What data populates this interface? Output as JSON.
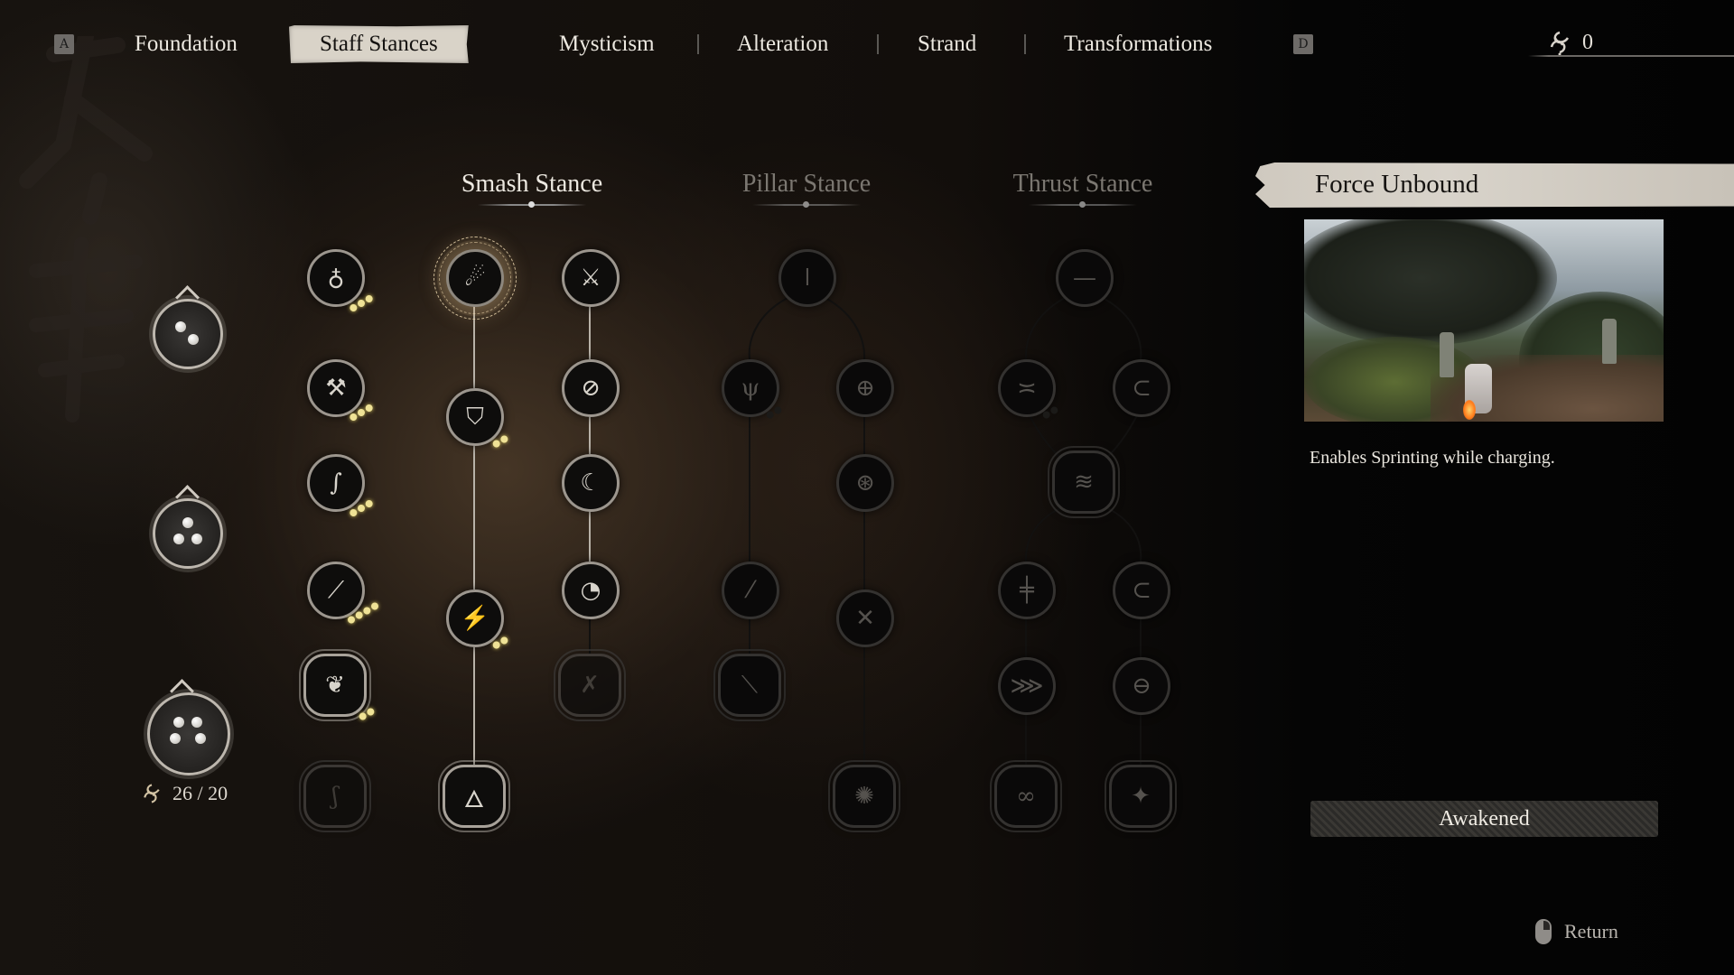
{
  "nav": {
    "left_key": "A",
    "right_key": "D",
    "tabs": [
      {
        "label": "Foundation",
        "active": false
      },
      {
        "label": "Staff Stances",
        "active": true
      },
      {
        "label": "Mysticism",
        "active": false
      },
      {
        "label": "Alteration",
        "active": false
      },
      {
        "label": "Strand",
        "active": false
      },
      {
        "label": "Transformations",
        "active": false
      }
    ],
    "currency": {
      "icon": "spark-swirl-icon",
      "value": "0"
    }
  },
  "essence": {
    "tiers": [
      {
        "name": "tier-2",
        "dots": 2
      },
      {
        "name": "tier-3",
        "dots": 3
      },
      {
        "name": "tier-4",
        "dots": 4
      }
    ],
    "count": "26 / 20"
  },
  "stances": [
    {
      "title": "Smash Stance",
      "active": true
    },
    {
      "title": "Pillar Stance",
      "active": false
    },
    {
      "title": "Thrust Stance",
      "active": false
    }
  ],
  "skill_nodes": {
    "column_a": [
      {
        "icon": "flame-drop-icon",
        "pips": [
          1,
          1,
          1
        ],
        "state": "unlocked"
      },
      {
        "icon": "staff-grip-icon",
        "pips": [
          1,
          1,
          1
        ],
        "state": "unlocked"
      },
      {
        "icon": "staff-swing-icon",
        "pips": [
          1,
          1,
          1
        ],
        "state": "unlocked"
      },
      {
        "icon": "staff-charge-icon",
        "pips": [
          1,
          1,
          1,
          1
        ],
        "state": "unlocked"
      },
      {
        "icon": "staff-spiral-icon",
        "pips": [
          1,
          1
        ],
        "state": "unlocked",
        "ornate": true
      },
      {
        "icon": "staff-whirl-icon",
        "pips": [],
        "state": "locked",
        "ornate": true
      }
    ],
    "smash_main": [
      {
        "icon": "force-unbound-icon",
        "pips": [],
        "state": "selected"
      },
      {
        "icon": "shield-staff-icon",
        "pips": [
          1,
          1
        ],
        "state": "unlocked"
      },
      {
        "icon": "staff-strike-icon",
        "pips": [
          1,
          1
        ],
        "state": "unlocked"
      },
      {
        "icon": "staff-flame-icon",
        "pips": [],
        "state": "unlocked",
        "ornate": true
      }
    ],
    "smash_side": [
      {
        "icon": "crossed-staff-icon",
        "state": "unlocked"
      },
      {
        "icon": "staff-arc-icon",
        "state": "unlocked"
      },
      {
        "icon": "crescent-icon",
        "state": "unlocked"
      },
      {
        "icon": "crescent-flame-icon",
        "state": "unlocked"
      },
      {
        "icon": "crossed-staff-flame-icon",
        "state": "faded",
        "ornate": true
      }
    ],
    "pillar": [
      {
        "icon": "pillar-top-icon",
        "state": "locked"
      },
      {
        "icon": "pillar-sprout-icon",
        "pips": [
          0,
          0
        ],
        "state": "locked"
      },
      {
        "icon": "pillar-ring-icon",
        "state": "locked"
      },
      {
        "icon": "pillar-vortex-icon",
        "state": "locked"
      },
      {
        "icon": "pillar-lean-icon",
        "state": "locked"
      },
      {
        "icon": "pillar-cross-icon",
        "state": "locked"
      },
      {
        "icon": "pillar-fall-icon",
        "state": "locked",
        "ornate": true
      },
      {
        "icon": "pillar-spin-icon",
        "state": "locked",
        "ornate": true
      }
    ],
    "thrust": [
      {
        "icon": "thrust-line-icon",
        "state": "locked"
      },
      {
        "icon": "thrust-dash-icon",
        "pips": [
          0,
          0
        ],
        "state": "locked"
      },
      {
        "icon": "thrust-loop-icon",
        "state": "locked"
      },
      {
        "icon": "thrust-rush-icon",
        "state": "locked",
        "ornate": true
      },
      {
        "icon": "thrust-cross-icon",
        "state": "locked"
      },
      {
        "icon": "thrust-sweep-icon",
        "state": "locked"
      },
      {
        "icon": "thrust-feather-icon",
        "state": "locked"
      },
      {
        "icon": "thrust-orb-icon",
        "state": "locked"
      },
      {
        "icon": "thrust-wave-icon",
        "state": "locked",
        "ornate": true
      },
      {
        "icon": "thrust-star-icon",
        "state": "locked",
        "ornate": true
      }
    ]
  },
  "detail": {
    "title": "Force Unbound",
    "description": "Enables Sprinting while charging.",
    "status": "Awakened"
  },
  "footer": {
    "return_label": "Return",
    "return_icon": "mouse-right-click-icon"
  }
}
